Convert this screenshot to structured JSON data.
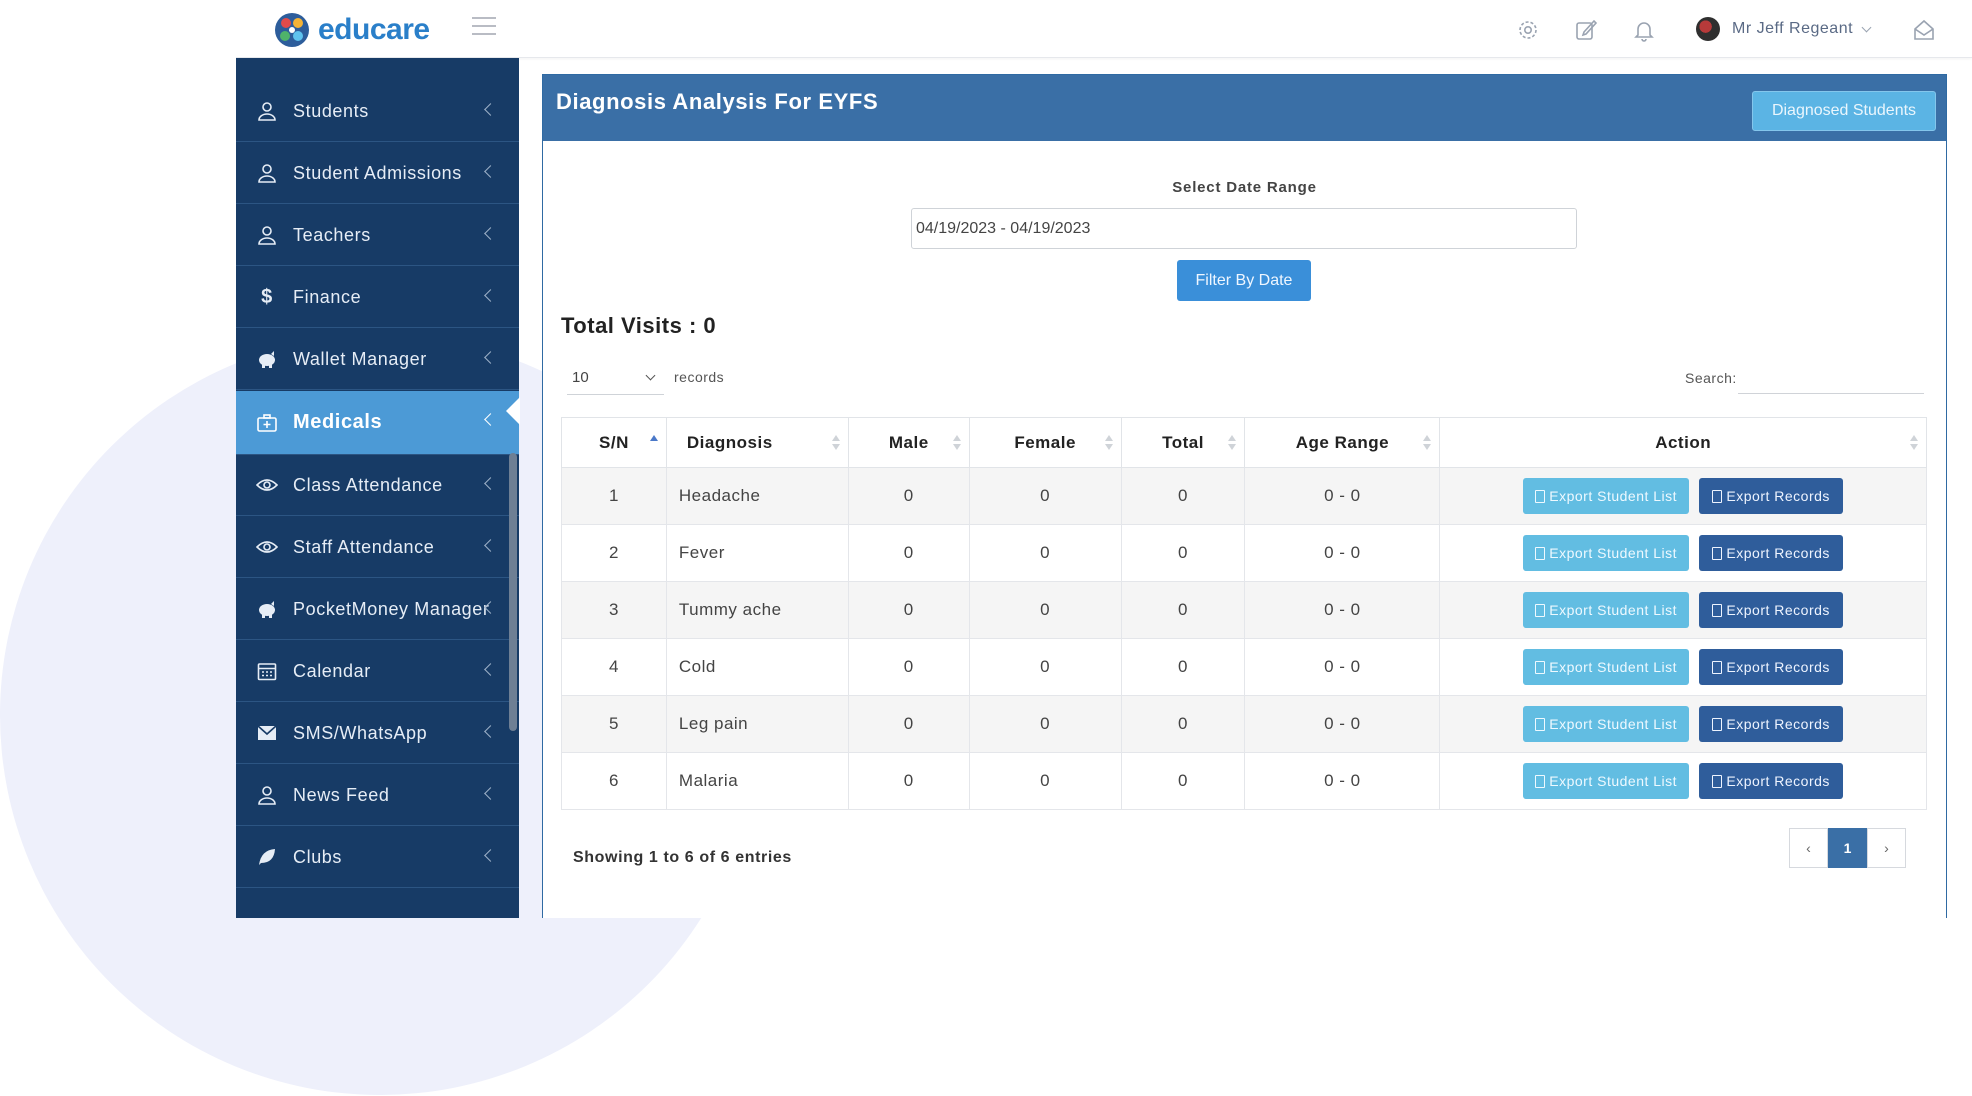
{
  "brand": {
    "name": "educare"
  },
  "topbar": {
    "icons": [
      "gear-icon",
      "edit-icon",
      "bell-icon",
      "home-icon"
    ],
    "user_name": "Mr Jeff Regeant"
  },
  "sidebar": {
    "active_color": "#4c9ad6",
    "items": [
      {
        "label": "Students",
        "icon": "user-icon"
      },
      {
        "label": "Student Admissions",
        "icon": "user-icon"
      },
      {
        "label": "Teachers",
        "icon": "user-icon"
      },
      {
        "label": "Finance",
        "icon": "dollar-icon"
      },
      {
        "label": "Wallet Manager",
        "icon": "piggy-bank-icon"
      },
      {
        "label": "Medicals",
        "icon": "medkit-icon"
      },
      {
        "label": "Class Attendance",
        "icon": "eye-icon"
      },
      {
        "label": "Staff Attendance",
        "icon": "eye-icon"
      },
      {
        "label": "PocketMoney Manager",
        "icon": "piggy-bank-icon"
      },
      {
        "label": "Calendar",
        "icon": "calendar-icon"
      },
      {
        "label": "SMS/WhatsApp",
        "icon": "envelope-icon"
      },
      {
        "label": "News Feed",
        "icon": "user-icon"
      },
      {
        "label": "Clubs",
        "icon": "leaf-icon"
      }
    ]
  },
  "panel": {
    "title": "Diagnosis Analysis For EYFS",
    "diagnosed_button": "Diagnosed Students",
    "date_range_label": "Select Date Range",
    "date_range_value": "04/19/2023 - 04/19/2023",
    "filter_button": "Filter By Date",
    "total_visits": "Total Visits : 0",
    "page_length": "10",
    "records_label": "records",
    "search_label": "Search:",
    "showing": "Showing 1 to 6 of 6 entries",
    "pagination": {
      "prev": "‹",
      "current": "1",
      "next": "›"
    }
  },
  "table": {
    "columns": [
      "S/N",
      "Diagnosis",
      "Male",
      "Female",
      "Total",
      "Age Range",
      "Action"
    ],
    "export_list_label": "Export Student List",
    "export_records_label": "Export Records",
    "rows": [
      {
        "sn": "1",
        "diagnosis": "Headache",
        "male": "0",
        "female": "0",
        "total": "0",
        "age_range": "0 - 0"
      },
      {
        "sn": "2",
        "diagnosis": "Fever",
        "male": "0",
        "female": "0",
        "total": "0",
        "age_range": "0 - 0"
      },
      {
        "sn": "3",
        "diagnosis": "Tummy ache",
        "male": "0",
        "female": "0",
        "total": "0",
        "age_range": "0 - 0"
      },
      {
        "sn": "4",
        "diagnosis": "Cold",
        "male": "0",
        "female": "0",
        "total": "0",
        "age_range": "0 - 0"
      },
      {
        "sn": "5",
        "diagnosis": "Leg pain",
        "male": "0",
        "female": "0",
        "total": "0",
        "age_range": "0 - 0"
      },
      {
        "sn": "6",
        "diagnosis": "Malaria",
        "male": "0",
        "female": "0",
        "total": "0",
        "age_range": "0 - 0"
      }
    ]
  }
}
